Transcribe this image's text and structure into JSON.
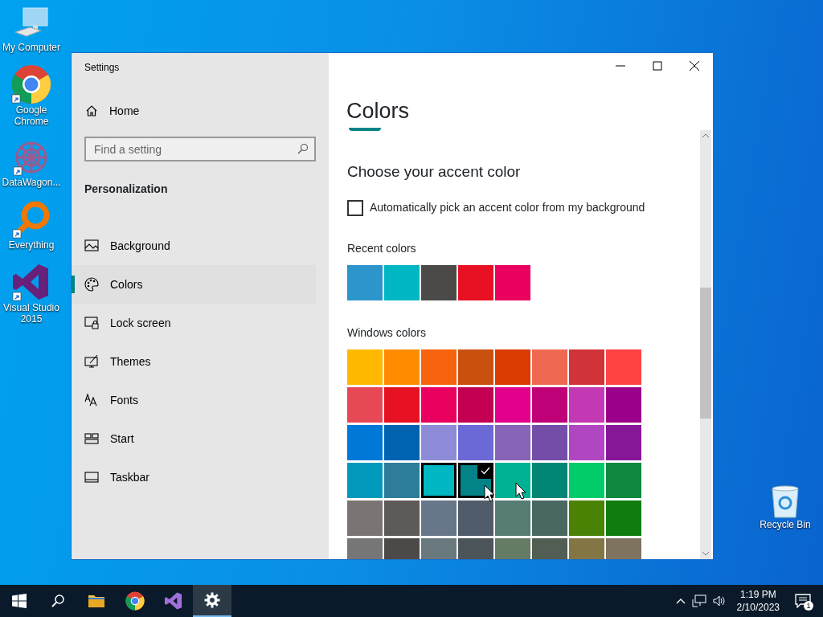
{
  "desktop_icons": [
    {
      "label": "My Computer",
      "kind": "computer"
    },
    {
      "label": "Google Chrome",
      "kind": "chrome"
    },
    {
      "label": "DataWagon...",
      "kind": "datawagon"
    },
    {
      "label": "Everything",
      "kind": "everything"
    },
    {
      "label": "Visual Studio 2015",
      "kind": "vs"
    },
    {
      "label": "Recycle Bin",
      "kind": "recycle"
    }
  ],
  "window": {
    "title": "Settings"
  },
  "sidebar": {
    "home": "Home",
    "search": {
      "placeholder": "Find a setting"
    },
    "section": "Personalization",
    "items": [
      {
        "label": "Background",
        "selected": false
      },
      {
        "label": "Colors",
        "selected": true
      },
      {
        "label": "Lock screen",
        "selected": false
      },
      {
        "label": "Themes",
        "selected": false
      },
      {
        "label": "Fonts",
        "selected": false
      },
      {
        "label": "Start",
        "selected": false
      },
      {
        "label": "Taskbar",
        "selected": false
      }
    ]
  },
  "content": {
    "title": "Colors",
    "heading": "Choose your accent color",
    "auto_pick": {
      "label": "Automatically pick an accent color from my background",
      "checked": false
    },
    "recent_label": "Recent colors",
    "recent_colors": [
      {
        "color": "#2b95cc"
      },
      {
        "color": "#00b7c3"
      },
      {
        "color": "#4c4a48"
      },
      {
        "color": "#e81123"
      },
      {
        "color": "#ea005e"
      }
    ],
    "windows_label": "Windows colors",
    "windows_colors": [
      {
        "color": "#ffb900",
        "selected": false,
        "hovered": false
      },
      {
        "color": "#ff8c00",
        "selected": false,
        "hovered": false
      },
      {
        "color": "#f7630c",
        "selected": false,
        "hovered": false
      },
      {
        "color": "#ca5010",
        "selected": false,
        "hovered": false
      },
      {
        "color": "#da3b01",
        "selected": false,
        "hovered": false
      },
      {
        "color": "#ef6950",
        "selected": false,
        "hovered": false
      },
      {
        "color": "#d13438",
        "selected": false,
        "hovered": false
      },
      {
        "color": "#ff4343",
        "selected": false,
        "hovered": false
      },
      {
        "color": "#e74856",
        "selected": false,
        "hovered": false
      },
      {
        "color": "#e81123",
        "selected": false,
        "hovered": false
      },
      {
        "color": "#ea005e",
        "selected": false,
        "hovered": false
      },
      {
        "color": "#c30052",
        "selected": false,
        "hovered": false
      },
      {
        "color": "#e3008c",
        "selected": false,
        "hovered": false
      },
      {
        "color": "#bf0077",
        "selected": false,
        "hovered": false
      },
      {
        "color": "#c239b3",
        "selected": false,
        "hovered": false
      },
      {
        "color": "#9a0089",
        "selected": false,
        "hovered": false
      },
      {
        "color": "#0078d7",
        "selected": false,
        "hovered": false
      },
      {
        "color": "#0063b1",
        "selected": false,
        "hovered": false
      },
      {
        "color": "#8e8cd8",
        "selected": false,
        "hovered": false
      },
      {
        "color": "#6b69d6",
        "selected": false,
        "hovered": false
      },
      {
        "color": "#8764b8",
        "selected": false,
        "hovered": false
      },
      {
        "color": "#744da9",
        "selected": false,
        "hovered": false
      },
      {
        "color": "#b146c2",
        "selected": false,
        "hovered": false
      },
      {
        "color": "#881798",
        "selected": false,
        "hovered": false
      },
      {
        "color": "#0099bc",
        "selected": false,
        "hovered": false
      },
      {
        "color": "#2d7d9a",
        "selected": false,
        "hovered": false
      },
      {
        "color": "#00b7c3",
        "selected": false,
        "hovered": true
      },
      {
        "color": "#038387",
        "selected": true,
        "hovered": false
      },
      {
        "color": "#00b294",
        "selected": false,
        "hovered": false
      },
      {
        "color": "#018574",
        "selected": false,
        "hovered": false
      },
      {
        "color": "#00cc6a",
        "selected": false,
        "hovered": false
      },
      {
        "color": "#10893e",
        "selected": false,
        "hovered": false
      },
      {
        "color": "#7a7574",
        "selected": false,
        "hovered": false
      },
      {
        "color": "#5d5a58",
        "selected": false,
        "hovered": false
      },
      {
        "color": "#68768a",
        "selected": false,
        "hovered": false
      },
      {
        "color": "#515c6b",
        "selected": false,
        "hovered": false
      },
      {
        "color": "#567c73",
        "selected": false,
        "hovered": false
      },
      {
        "color": "#486860",
        "selected": false,
        "hovered": false
      },
      {
        "color": "#498205",
        "selected": false,
        "hovered": false
      },
      {
        "color": "#107c10",
        "selected": false,
        "hovered": false
      },
      {
        "color": "#767676",
        "selected": false,
        "hovered": false
      },
      {
        "color": "#4c4a48",
        "selected": false,
        "hovered": false
      },
      {
        "color": "#69797e",
        "selected": false,
        "hovered": false
      },
      {
        "color": "#4a5459",
        "selected": false,
        "hovered": false
      },
      {
        "color": "#647c64",
        "selected": false,
        "hovered": false
      },
      {
        "color": "#525e54",
        "selected": false,
        "hovered": false
      },
      {
        "color": "#847545",
        "selected": false,
        "hovered": false
      },
      {
        "color": "#7e735f",
        "selected": false,
        "hovered": false
      }
    ]
  },
  "taskbar": {
    "apps": [
      {
        "kind": "explorer",
        "active": false
      },
      {
        "kind": "chrome",
        "active": false
      },
      {
        "kind": "vs",
        "active": false
      },
      {
        "kind": "settings",
        "active": true
      }
    ],
    "time": "1:19 PM",
    "date": "2/10/2023",
    "notifications": "1"
  }
}
